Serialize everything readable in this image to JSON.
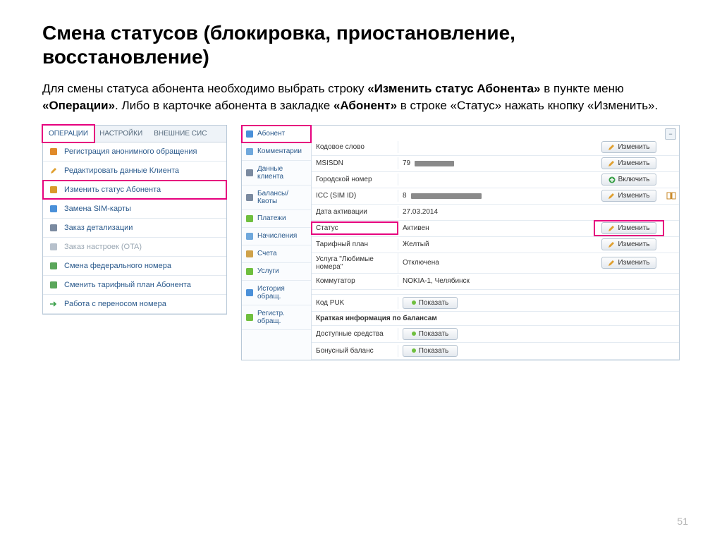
{
  "title": "Смена статусов (блокировка, приостановление, восстановление)",
  "description": {
    "t1": "Для смены статуса абонента необходимо выбрать строку ",
    "b1": "«Изменить статус Абонента»",
    "t2": " в пункте меню ",
    "b2": "«Операции»",
    "t3": ". Либо в карточке абонента в закладке ",
    "b3": "«Абонент»",
    "t4": " в строке «Статус» нажать кнопку «Изменить»."
  },
  "ops": {
    "tabs": [
      "ОПЕРАЦИИ",
      "НАСТРОЙКИ",
      "ВНЕШНИЕ СИС"
    ],
    "items": [
      {
        "icon": "user",
        "label": "Регистрация анонимного обращения"
      },
      {
        "icon": "pencil",
        "label": "Редактировать данные Клиента"
      },
      {
        "icon": "status",
        "label": "Изменить статус Абонента"
      },
      {
        "icon": "sim",
        "label": "Замена SIM-карты"
      },
      {
        "icon": "detail",
        "label": "Заказ детализации"
      },
      {
        "icon": "ota",
        "label": "Заказ настроек (OTA)"
      },
      {
        "icon": "phone",
        "label": "Смена федерального номера"
      },
      {
        "icon": "tariff",
        "label": "Сменить тарифный план Абонента"
      },
      {
        "icon": "transfer",
        "label": "Работа с переносом номера"
      }
    ]
  },
  "card": {
    "side": [
      {
        "icon": "abon",
        "label": "Абонент"
      },
      {
        "icon": "comment",
        "label": "Комментарии"
      },
      {
        "icon": "client",
        "label": "Данные клиента"
      },
      {
        "icon": "balance",
        "label": "Балансы/Квоты"
      },
      {
        "icon": "pay",
        "label": "Платежи"
      },
      {
        "icon": "accr",
        "label": "Начисления"
      },
      {
        "icon": "acct",
        "label": "Счета"
      },
      {
        "icon": "svc",
        "label": "Услуги"
      },
      {
        "icon": "hist",
        "label": "История обращ."
      },
      {
        "icon": "reg",
        "label": "Регистр. обращ."
      }
    ],
    "rows": [
      {
        "label": "Кодовое слово",
        "value": "",
        "btn": "Изменить",
        "btnIcon": "pencil"
      },
      {
        "label": "MSISDN",
        "value": "79",
        "mask": 56,
        "btn": "Изменить",
        "btnIcon": "pencil"
      },
      {
        "label": "Городской номер",
        "value": "",
        "btn": "Включить",
        "btnIcon": "plus"
      },
      {
        "label": "ICC (SIM ID)",
        "value": "8",
        "mask": 100,
        "btn": "Изменить",
        "btnIcon": "pencil",
        "book": true
      },
      {
        "label": "Дата активации",
        "value": "27.03.2014"
      },
      {
        "label": "Статус",
        "value": "Активен",
        "btn": "Изменить",
        "btnIcon": "pencil",
        "hl": true
      },
      {
        "label": "Тарифный план",
        "value": "Желтый",
        "btn": "Изменить",
        "btnIcon": "pencil"
      },
      {
        "label": "Услуга \"Любимые номера\"",
        "value": "Отключена",
        "btn": "Изменить",
        "btnIcon": "pencil"
      },
      {
        "label": "Коммутатор",
        "value": "NOKIA-1, Челябинск"
      }
    ],
    "puk": {
      "label": "Код PUK",
      "btn": "Показать"
    },
    "balHeader": "Краткая информация по балансам",
    "bal": [
      {
        "label": "Доступные средства",
        "btn": "Показать"
      },
      {
        "label": "Бонусный баланс",
        "btn": "Показать"
      }
    ]
  },
  "page": "51"
}
